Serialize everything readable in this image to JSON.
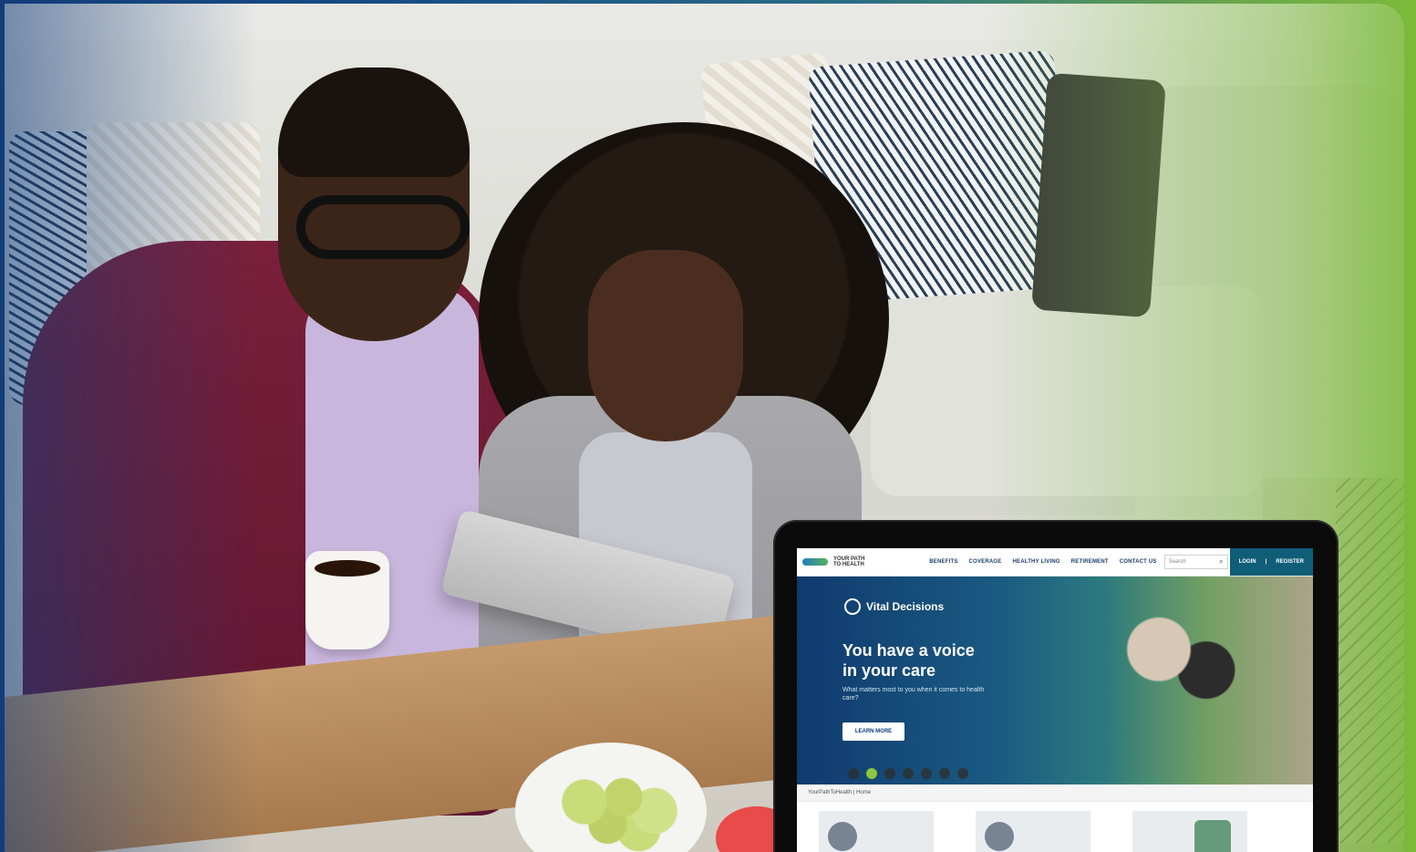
{
  "site": {
    "logo_text_top": "YOUR PATH",
    "logo_text_bottom": "TO HEALTH",
    "nav_items": [
      "BENEFITS",
      "COVERAGE",
      "HEALTHY LIVING",
      "RETIREMENT",
      "CONTACT US"
    ],
    "search_placeholder": "Search",
    "login_label": "LOGIN",
    "register_label": "REGISTER"
  },
  "hero": {
    "brand": "Vital Decisions",
    "headline_line1": "You have a voice",
    "headline_line2": "in your care",
    "subtext": "What matters most to you when it comes to health care?",
    "cta_label": "LEARN MORE",
    "slides_total": 7,
    "active_slide": 2
  },
  "breadcrumb": "YourPathToHealth | Home",
  "colors": {
    "navy": "#0f3d7a",
    "teal": "#0f5d77",
    "green": "#8cc63f"
  }
}
